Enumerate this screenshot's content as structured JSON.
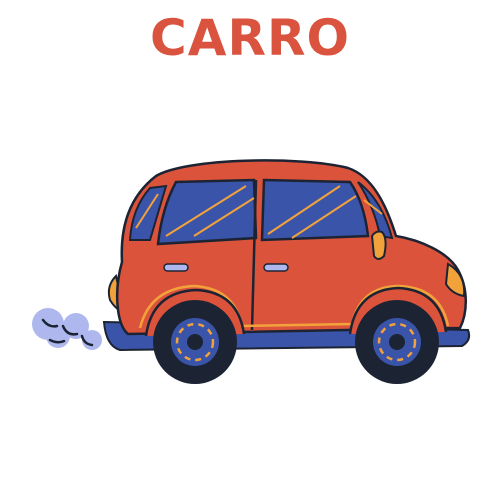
{
  "title": {
    "text": "CARRO",
    "color": "#d9533f"
  },
  "illustration": {
    "subject": "car-illustration",
    "colors": {
      "body": "#dc533b",
      "windows": "#3a54a9",
      "trim": "#f2a23a",
      "outline": "#1c2434",
      "wheels": "#1c2434",
      "hubcaps": "#3a54a9",
      "skirt": "#3a54a9",
      "exhaust": "#aeb8ee",
      "lights": "#f2a23a"
    }
  }
}
